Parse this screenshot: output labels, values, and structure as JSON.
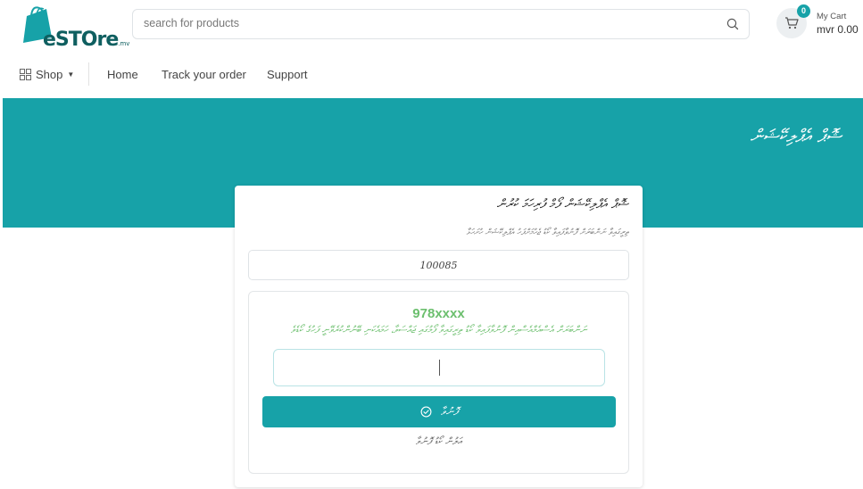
{
  "header": {
    "logo": {
      "text_main": "eSTOre",
      "text_suffix": ".mv",
      "icon": "shopping-bag-icon"
    },
    "search": {
      "placeholder": "search for products",
      "icon": "search-icon"
    },
    "cart": {
      "count": "0",
      "label": "My Cart",
      "total": "mvr 0.00",
      "icon": "cart-icon"
    }
  },
  "nav": {
    "shop_label": "Shop",
    "links": [
      "Home",
      "Track your order",
      "Support"
    ]
  },
  "banner": {
    "title": "ޝޮޕް އެޕްލިކޭޝަން"
  },
  "card": {
    "title": "ޝޮޕް އެޕްލިކޭޝަން ފޯމް ފުރިހަމަ ކުރުން",
    "subtitle": "ތިރީގައިވާ ނަންބަރަށް ފޮނުވާފައިވާ ކޯޑު ޖެހުމަށްފަހު އެޕްލިކޭޝަން ހުށަހަޅާ",
    "id_value": "100085",
    "phone": "978xxxx",
    "otp_message": "ނަންބަރަށް އެސްއެމްއެސްއިން ފޮނުވާފައިވާ ކޯޑު ތިރީގައިވާ ފޯމުގައި ޖައްސަވާ، ހަމައެކަނި ބޭނުންކުރެވޭނީ ފަހުގެ ކޯޑެވެ",
    "submit_label": "ފޮނުވާ",
    "resend_label": "އަލުން ކޯޑު ފޮނުވާ"
  },
  "colors": {
    "accent": "#17a2a8",
    "phone_green": "#6cbf6e",
    "logo_dark": "#0f5f60"
  }
}
